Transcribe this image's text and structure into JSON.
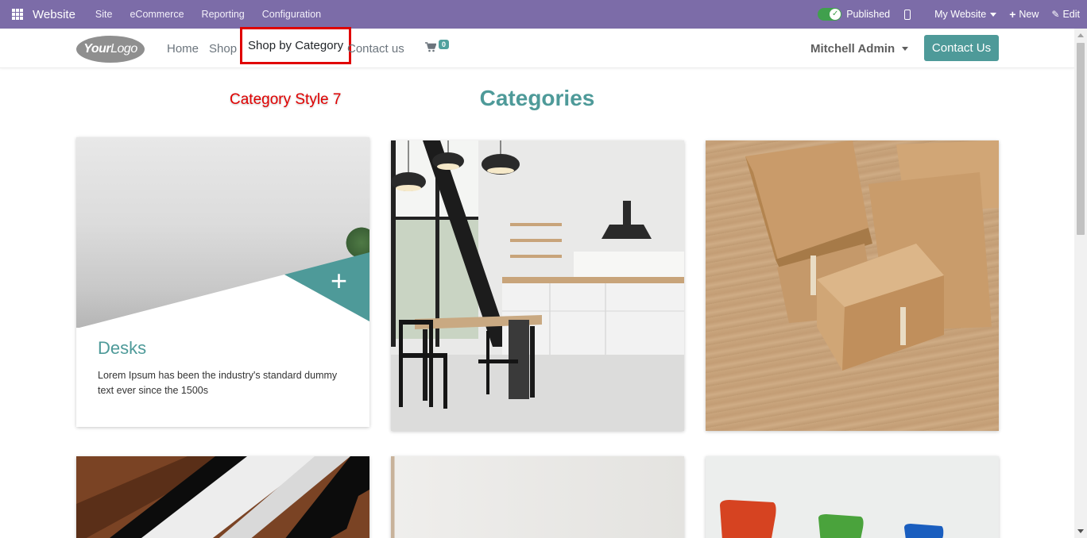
{
  "adminbar": {
    "brand": "Website",
    "menu": [
      "Site",
      "eCommerce",
      "Reporting",
      "Configuration"
    ],
    "published_label": "Published",
    "my_website_label": "My Website",
    "new_label": "New",
    "edit_label": "Edit",
    "bg_color": "#7c6ca8"
  },
  "header": {
    "logo_bold": "Your",
    "logo_light": "Logo",
    "nav": {
      "home": "Home",
      "shop": "Shop",
      "shop_by_category": "Shop by Category",
      "contact": "Contact us"
    },
    "cart_count": "0",
    "user_name": "Mitchell Admin",
    "contact_button": "Contact Us"
  },
  "page": {
    "style_label": "Category Style 7",
    "title": "Categories",
    "accent_color": "#4e9a99",
    "highlight_color": "#e00000"
  },
  "cards": [
    {
      "title": "Desks",
      "description": "Lorem Ipsum has been the industry's standard dummy text ever since the 1500s",
      "image": "desk-room-image"
    },
    {
      "image": "kitchen-dining-image"
    },
    {
      "image": "cardboard-boxes-image"
    },
    {
      "image": "wood-drawer-image"
    },
    {
      "image": "bright-wall-image"
    },
    {
      "image": "colorful-chairs-image"
    }
  ]
}
